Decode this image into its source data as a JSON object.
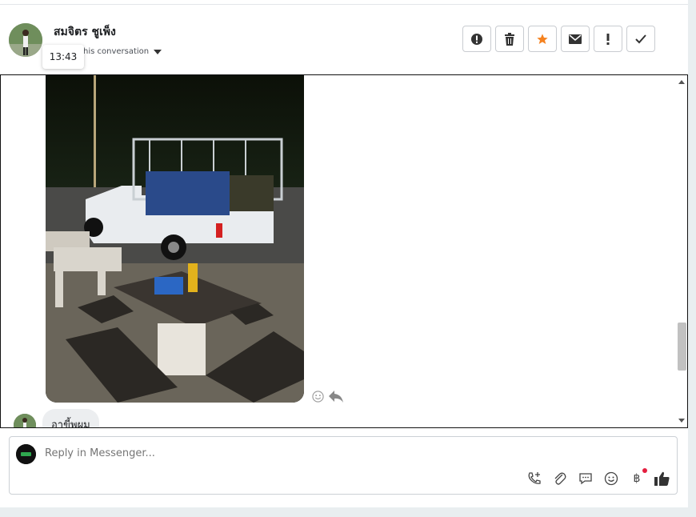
{
  "header": {
    "contact_name": "สมจิตร ชูเพ็ง",
    "assign_label": "his conversation",
    "tooltip_time": "13:43",
    "actions": [
      {
        "name": "mark-spam-button",
        "icon": "alert-circle-icon"
      },
      {
        "name": "delete-button",
        "icon": "trash-icon"
      },
      {
        "name": "star-button",
        "icon": "star-icon"
      },
      {
        "name": "mark-unread-button",
        "icon": "envelope-icon"
      },
      {
        "name": "follow-up-button",
        "icon": "exclamation-icon"
      },
      {
        "name": "mark-done-button",
        "icon": "checkmark-icon"
      }
    ]
  },
  "conversation": {
    "last_message": "อาขี้พผม"
  },
  "reply": {
    "placeholder": "Reply in Messenger...",
    "tools": [
      "phone-plus-icon",
      "paperclip-icon",
      "chat-bubble-icon",
      "smile-icon",
      "baht-icon",
      "thumbs-up-icon"
    ]
  },
  "colors": {
    "star": "#f5821f",
    "badge": "#e41e3f"
  }
}
